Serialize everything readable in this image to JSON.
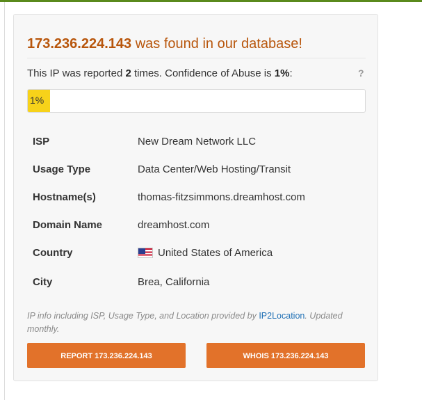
{
  "result": {
    "ip": "173.236.224.143",
    "found_text": " was found in our database!",
    "report_prefix": "This IP was reported ",
    "report_count": "2",
    "report_mid": " times. Confidence of Abuse is ",
    "confidence": "1%",
    "report_suffix": ":",
    "help": "?",
    "confidence_value": 1,
    "progress_color": "#f7d21a"
  },
  "details": [
    {
      "key": "ISP",
      "value": "New Dream Network LLC"
    },
    {
      "key": "Usage Type",
      "value": "Data Center/Web Hosting/Transit"
    },
    {
      "key": "Hostname(s)",
      "value": "thomas-fitzsimmons.dreamhost.com"
    },
    {
      "key": "Domain Name",
      "value": "dreamhost.com"
    },
    {
      "key": "Country",
      "value": "United States of America",
      "icon": "us-flag-icon"
    },
    {
      "key": "City",
      "value": "Brea, California"
    }
  ],
  "attribution": {
    "prefix": "IP info including ISP, Usage Type, and Location provided by ",
    "link": "IP2Location",
    "suffix": ". Updated monthly."
  },
  "buttons": {
    "report": "REPORT 173.236.224.143",
    "whois": "WHOIS 173.236.224.143"
  },
  "colors": {
    "accent": "#e2722a",
    "headline": "#b8560c",
    "top_bar": "#5a8a1c",
    "link": "#1e6fb5"
  }
}
